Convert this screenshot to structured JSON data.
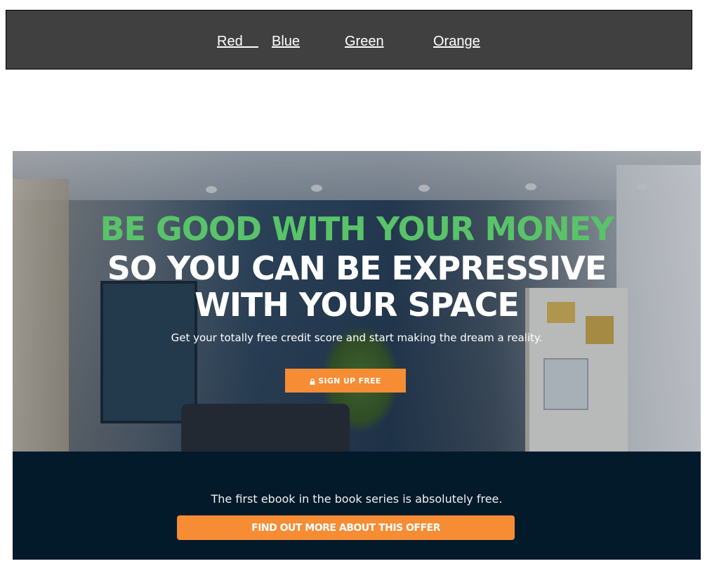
{
  "nav": {
    "links": [
      {
        "label": "Red    "
      },
      {
        "label": "Blue"
      },
      {
        "label": "Green"
      },
      {
        "label": "Orange"
      }
    ]
  },
  "hero": {
    "line1": "BE GOOD WITH YOUR MONEY",
    "line2": "SO YOU CAN BE EXPRESSIVE",
    "line3": "WITH YOUR SPACE",
    "subtext": "Get your totally free credit score and start making the dream a reality.",
    "cta_label": "SIGN UP FREE",
    "cta_icon": "lock-icon"
  },
  "band": {
    "text": "The first ebook in the book series is absolutely free.",
    "button_label": "FIND OUT MORE ABOUT THIS OFFER"
  },
  "colors": {
    "nav_bg": "#404040",
    "accent_green": "#59c36a",
    "cta_orange": "#f68c34",
    "band_bg": "#031a2b"
  }
}
